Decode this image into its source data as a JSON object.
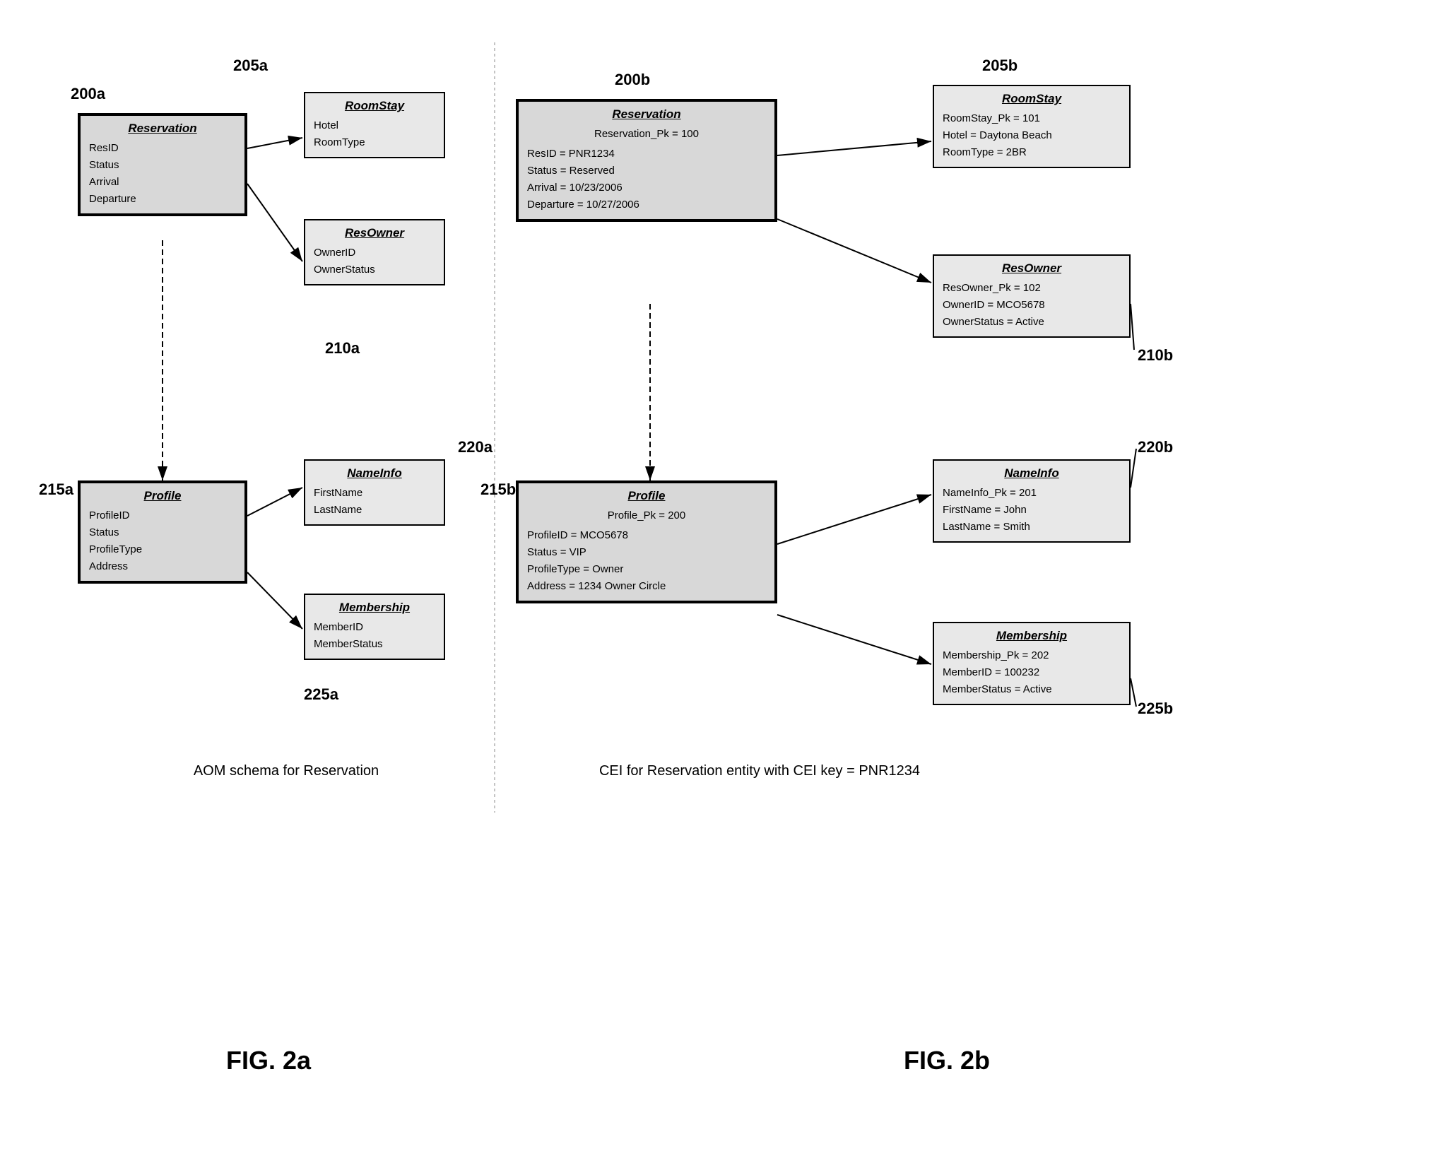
{
  "fig2a": {
    "title": "FIG. 2a",
    "caption": "AOM schema for Reservation",
    "label_200a": "200a",
    "label_205a": "205a",
    "label_210a": "210a",
    "label_215a": "215a",
    "label_220a": "220a",
    "label_225a": "225a",
    "reservation_box": {
      "title": "Reservation",
      "fields": [
        "ResID",
        "Status",
        "Arrival",
        "Departure"
      ]
    },
    "roomstay_box": {
      "title": "RoomStay",
      "fields": [
        "Hotel",
        "RoomType"
      ]
    },
    "resowner_box": {
      "title": "ResOwner",
      "fields": [
        "OwnerID",
        "OwnerStatus"
      ]
    },
    "profile_box": {
      "title": "Profile",
      "fields": [
        "ProfileID",
        "Status",
        "ProfileType",
        "Address"
      ]
    },
    "nameinfo_box": {
      "title": "NameInfo",
      "fields": [
        "FirstName",
        "LastName"
      ]
    },
    "membership_box": {
      "title": "Membership",
      "fields": [
        "MemberID",
        "MemberStatus"
      ]
    }
  },
  "fig2b": {
    "title": "FIG. 2b",
    "caption": "CEI for Reservation entity with  CEI key = PNR1234",
    "label_200b": "200b",
    "label_205b": "205b",
    "label_210b": "210b",
    "label_215b": "215b",
    "label_220b": "220b",
    "label_225b": "225b",
    "reservation_box": {
      "title": "Reservation",
      "pk": "Reservation_Pk = 100",
      "fields": [
        "ResID = PNR1234",
        "Status = Reserved",
        "Arrival = 10/23/2006",
        "Departure = 10/27/2006"
      ]
    },
    "roomstay_box": {
      "title": "RoomStay",
      "pk": "RoomStay_Pk = 101",
      "fields": [
        "Hotel = Daytona Beach",
        "RoomType = 2BR"
      ]
    },
    "resowner_box": {
      "title": "ResOwner",
      "pk": "ResOwner_Pk = 102",
      "fields": [
        "OwnerID = MCO5678",
        "OwnerStatus = Active"
      ]
    },
    "profile_box": {
      "title": "Profile",
      "pk": "Profile_Pk = 200",
      "fields": [
        "ProfileID = MCO5678",
        "Status = VIP",
        "ProfileType = Owner",
        "Address = 1234 Owner Circle"
      ]
    },
    "nameinfo_box": {
      "title": "NameInfo",
      "pk": "NameInfo_Pk = 201",
      "fields": [
        "FirstName = John",
        "LastName = Smith"
      ]
    },
    "membership_box": {
      "title": "Membership",
      "pk": "Membership_Pk = 202",
      "fields": [
        "MemberID = 100232",
        "MemberStatus = Active"
      ]
    }
  }
}
